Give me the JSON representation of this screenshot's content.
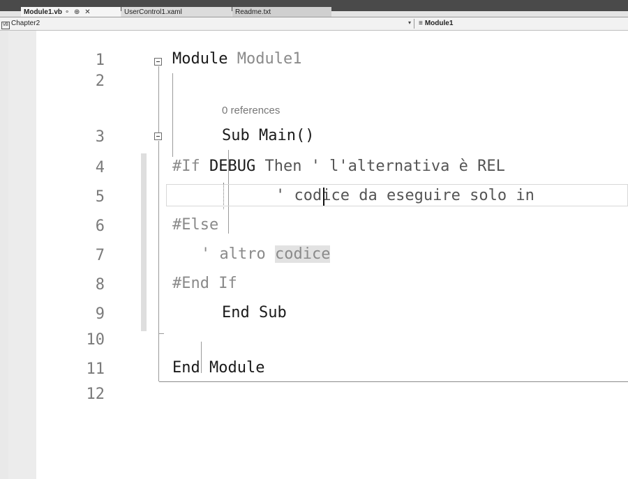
{
  "tabs": [
    {
      "label": "Module1.vb",
      "icons": "∘ ⊕ ✕",
      "active": true
    },
    {
      "label": "UserControl1.xaml",
      "active": false
    },
    {
      "label": "Readme.txt",
      "active": false
    }
  ],
  "navbar": {
    "project_icon": "vb-project-icon",
    "project": "Chapter2",
    "dropdown_arrow": "▾",
    "member_icon": "module-icon",
    "member": "Module1"
  },
  "editor": {
    "line_numbers": [
      "1",
      "2",
      "3",
      "4",
      "5",
      "6",
      "7",
      "8",
      "9",
      "10",
      "11",
      "12"
    ],
    "codelens": "0 references",
    "lines": {
      "l1_kw": "Module",
      "l1_name": " Module1",
      "l3_kw": "Sub ",
      "l3_name": "Main()",
      "l4_a": "#If ",
      "l4_b": "DEBUG",
      "l4_c": " Then ' l'alternativa è REL",
      "l5": "' codice da eseguire solo in",
      "l6": "#Else",
      "l7_a": "' altro ",
      "l7_b": "codice",
      "l8": "#End If",
      "l9": "End Sub",
      "l11": "End Module"
    }
  },
  "colors": {
    "editor_bg": "#ffffff",
    "tabstrip_bg": "#4a4a4a",
    "inactive_text": "#8a8a8a"
  }
}
